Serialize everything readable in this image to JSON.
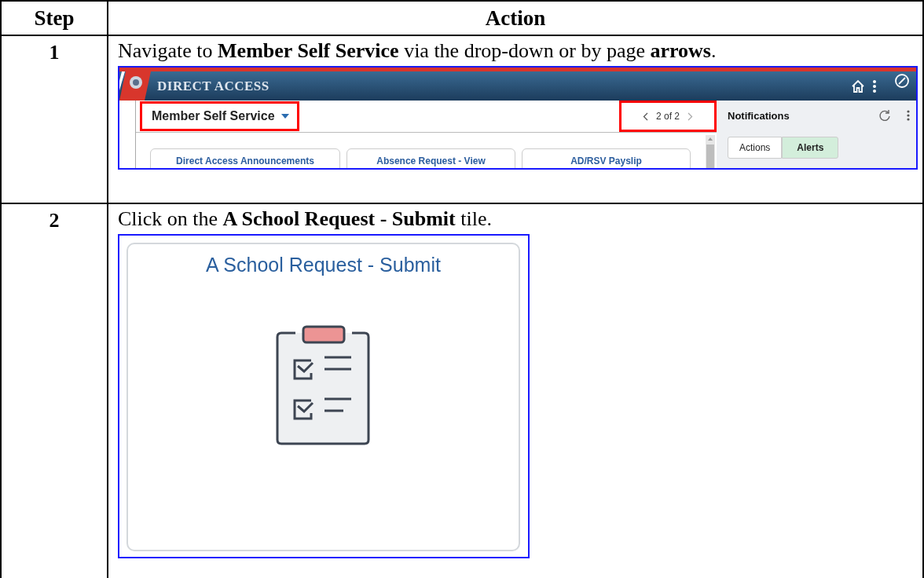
{
  "table": {
    "columns": [
      "Step",
      "Action"
    ],
    "rows": [
      {
        "step": "1",
        "instruction": "Navigate to **Member Self Service** via the drop-down or by page **arrows**.",
        "screenshot": {
          "kind": "portal",
          "app_title": "DIRECT ACCESS",
          "homepage_selector": "Member Self Service",
          "pager": "2 of 2",
          "tiles": [
            "Direct Access Announcements",
            "Absence Request - View",
            "AD/RSV Payslip"
          ],
          "notifications": {
            "title": "Notifications",
            "tabs": [
              {
                "label": "Actions",
                "selected": false
              },
              {
                "label": "Alerts",
                "selected": true
              }
            ]
          }
        }
      },
      {
        "step": "2",
        "instruction": "Click on the **A School Request - Submit** tile.",
        "screenshot": {
          "kind": "tile",
          "title": "A School Request - Submit"
        }
      }
    ]
  }
}
